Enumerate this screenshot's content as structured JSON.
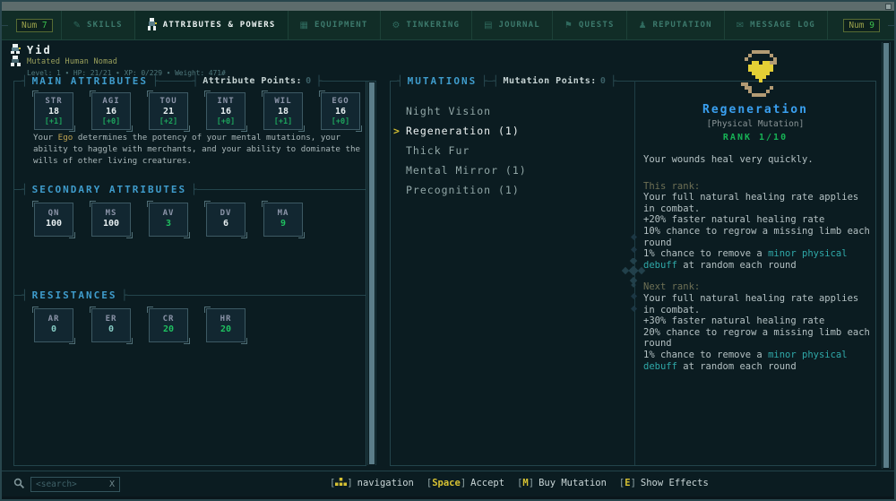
{
  "colors": {
    "accent_blue": "#3f9ccc",
    "title_blue": "#3aa0f0",
    "accent_green": "#1fc060",
    "accent_yellow": "#d6c133",
    "teal_text": "#2fa8a8",
    "dim_olive": "#6e7055",
    "body_text": "#b4c1c3",
    "panel_border": "#23444b",
    "tab_text": "#3d7a6d"
  },
  "decor": {
    "tick_left": "┤",
    "tick_right": "├"
  },
  "tabbar": {
    "left_hotkey": {
      "prefix": "Num",
      "number": "7"
    },
    "right_hotkey": {
      "prefix": "Num",
      "number": "9"
    },
    "tabs": [
      {
        "label": "SKILLS",
        "glyph": "✎"
      },
      {
        "label": "ATTRIBUTES & POWERS",
        "glyph": ""
      },
      {
        "label": "EQUIPMENT",
        "glyph": "▦"
      },
      {
        "label": "TINKERING",
        "glyph": "⚙"
      },
      {
        "label": "JOURNAL",
        "glyph": "▤"
      },
      {
        "label": "QUESTS",
        "glyph": "⚑"
      },
      {
        "label": "REPUTATION",
        "glyph": "♟"
      },
      {
        "label": "MESSAGE LOG",
        "glyph": "✉"
      }
    ]
  },
  "character": {
    "name": "Yid",
    "subtitle": "Mutated Human Nomad",
    "stats_line": "Level: 1 ∙ HP: 21/21 ∙ XP: 0/229 ∙ Weight: 471#"
  },
  "main_attributes": {
    "section_title": "MAIN ATTRIBUTES",
    "points_label": "Attribute Points:",
    "points_value": "0",
    "items": [
      {
        "abbr": "STR",
        "value": "18",
        "bonus": "[+1]"
      },
      {
        "abbr": "AGI",
        "value": "16",
        "bonus": "[+0]"
      },
      {
        "abbr": "TOU",
        "value": "21",
        "bonus": "[+2]"
      },
      {
        "abbr": "INT",
        "value": "16",
        "bonus": "[+0]"
      },
      {
        "abbr": "WIL",
        "value": "18",
        "bonus": "[+1]"
      },
      {
        "abbr": "EGO",
        "value": "16",
        "bonus": "[+0]"
      }
    ],
    "description": {
      "pre": "Your ",
      "highlight": "Ego",
      "post": " determines the potency of your mental mutations, your ability to haggle with merchants, and your ability to dominate the wills of other living creatures."
    }
  },
  "secondary_attributes": {
    "section_title": "SECONDARY ATTRIBUTES",
    "items": [
      {
        "abbr": "QN",
        "value": "100"
      },
      {
        "abbr": "MS",
        "value": "100"
      },
      {
        "abbr": "AV",
        "value": "3"
      },
      {
        "abbr": "DV",
        "value": "6"
      },
      {
        "abbr": "MA",
        "value": "9"
      }
    ]
  },
  "resistances": {
    "section_title": "RESISTANCES",
    "items": [
      {
        "abbr": "AR",
        "value": "0"
      },
      {
        "abbr": "ER",
        "value": "0"
      },
      {
        "abbr": "CR",
        "value": "20"
      },
      {
        "abbr": "HR",
        "value": "20"
      }
    ]
  },
  "mutations": {
    "section_title": "MUTATIONS",
    "points_label": "Mutation Points:",
    "points_value": "0",
    "cursor": ">",
    "items": [
      {
        "label": "Night Vision"
      },
      {
        "label": "Regeneration (1)"
      },
      {
        "label": "Thick Fur"
      },
      {
        "label": "Mental Mirror (1)"
      },
      {
        "label": "Precognition (1)"
      }
    ]
  },
  "detail": {
    "title": "Regeneration",
    "category": "[Physical Mutation]",
    "rank": "RANK 1/10",
    "summary": "Your wounds heal very quickly.",
    "this_rank": {
      "heading": "This rank:",
      "line1": "Your full natural healing rate applies in combat.",
      "line2": "+20% faster natural healing rate",
      "line3": "10% chance to regrow a missing limb each round",
      "line4_pre": "1% chance to remove a ",
      "line4_highlight": "minor physical debuff",
      "line4_post": " at random each round"
    },
    "next_rank": {
      "heading": "Next rank:",
      "line1": "Your full natural healing rate applies in combat.",
      "line2": "+30% faster natural healing rate",
      "line3": "20% chance to regrow a missing limb each round",
      "line4_pre": "1% chance to remove a ",
      "line4_highlight": "minor physical debuff",
      "line4_post": " at random each round"
    }
  },
  "search": {
    "placeholder": "<search>",
    "clear_label": "X"
  },
  "hotkeys": {
    "bracket_open": "[",
    "bracket_close": "]",
    "items": [
      {
        "key": "",
        "label": "navigation"
      },
      {
        "key": "Space",
        "label": "Accept"
      },
      {
        "key": "M",
        "label": "Buy Mutation"
      },
      {
        "key": "E",
        "label": "Show Effects"
      }
    ]
  }
}
